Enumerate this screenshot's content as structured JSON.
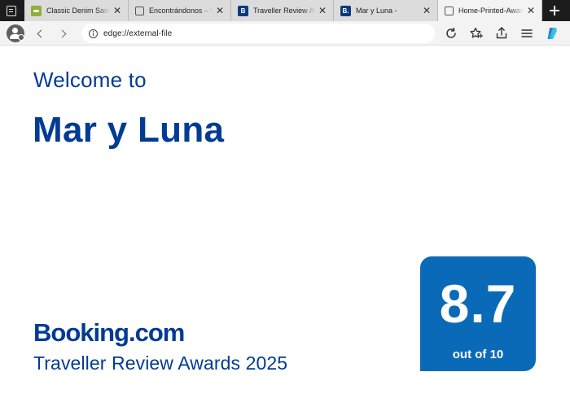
{
  "tabs": [
    {
      "title": "Classic Denim Sandals",
      "favicon": "green-logo-icon",
      "active": false
    },
    {
      "title": "Encontrándonos – D",
      "favicon": "page-icon",
      "active": false
    },
    {
      "title": "Traveller Review Awards",
      "favicon": "booking-b-icon",
      "favicon_letter": "B",
      "active": false
    },
    {
      "title": "Mar y Luna -",
      "favicon": "booking-b-icon",
      "favicon_letter": "B.",
      "active": false
    },
    {
      "title": "Home-Printed-Awards",
      "favicon": "page-icon",
      "active": true
    }
  ],
  "toolbar": {
    "url": "edge://external-file"
  },
  "page": {
    "welcome": "Welcome to",
    "hotel_name": "Mar y Luna",
    "brand": "Booking.com",
    "award": "Traveller Review Awards 2025",
    "score": "8.7",
    "score_sub": "out of 10"
  },
  "colors": {
    "brand_blue": "#003b95",
    "score_blue": "#0a6ab8"
  }
}
